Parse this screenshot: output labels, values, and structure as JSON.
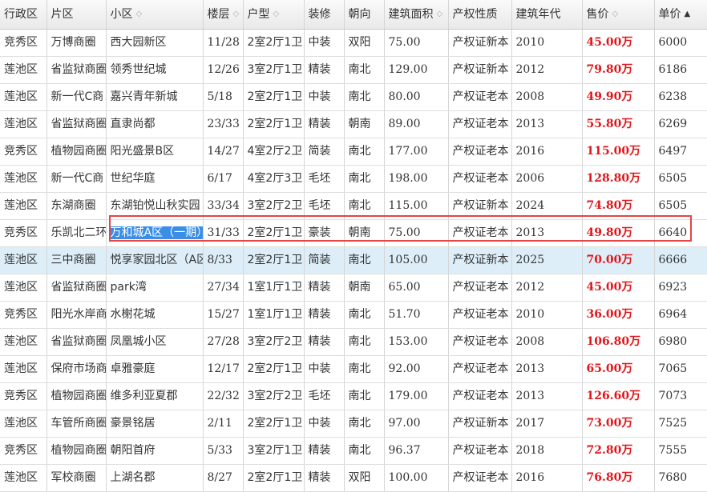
{
  "headers": [
    {
      "label": "行政区",
      "sort": ""
    },
    {
      "label": "片区",
      "sort": ""
    },
    {
      "label": "小区",
      "sort": "◇"
    },
    {
      "label": "楼层",
      "sort": "◇"
    },
    {
      "label": "户型",
      "sort": "◇"
    },
    {
      "label": "装修",
      "sort": ""
    },
    {
      "label": "朝向",
      "sort": ""
    },
    {
      "label": "建筑面积",
      "sort": "◇"
    },
    {
      "label": "产权性质",
      "sort": ""
    },
    {
      "label": "建筑年代",
      "sort": ""
    },
    {
      "label": "售价",
      "sort": "◇"
    },
    {
      "label": "单价",
      "sort": "▲"
    }
  ],
  "rows": [
    [
      "竞秀区",
      "万博商圈",
      "西大园新区",
      "11/28",
      "2室2厅1卫",
      "中装",
      "双阳",
      "75.00",
      "产权证新本",
      "2010",
      "45.00万",
      "6000"
    ],
    [
      "莲池区",
      "省监狱商圈",
      "领秀世纪城",
      "12/26",
      "3室2厅1卫",
      "精装",
      "南北",
      "129.00",
      "产权证新本",
      "2012",
      "79.80万",
      "6186"
    ],
    [
      "莲池区",
      "新一代C商",
      "嘉兴青年新城",
      "5/18",
      "2室2厅1卫",
      "中装",
      "南北",
      "80.00",
      "产权证老本",
      "2008",
      "49.90万",
      "6238"
    ],
    [
      "莲池区",
      "省监狱商圈",
      "直隶尚都",
      "23/33",
      "2室2厅1卫",
      "精装",
      "朝南",
      "89.00",
      "产权证老本",
      "2013",
      "55.80万",
      "6269"
    ],
    [
      "竞秀区",
      "植物园商圈",
      "阳光盛景B区",
      "14/27",
      "4室2厅2卫",
      "简装",
      "南北",
      "177.00",
      "产权证老本",
      "2016",
      "115.00万",
      "6497"
    ],
    [
      "莲池区",
      "新一代C商",
      "世纪华庭",
      "6/17",
      "4室2厅3卫",
      "毛坯",
      "南北",
      "198.00",
      "产权证老本",
      "2006",
      "128.80万",
      "6505"
    ],
    [
      "莲池区",
      "东湖商圈",
      "东湖铂悦山秋实园",
      "33/34",
      "3室2厅2卫",
      "毛坯",
      "南北",
      "115.00",
      "产权证新本",
      "2024",
      "74.80万",
      "6505"
    ],
    [
      "竞秀区",
      "乐凯北二环",
      "万和城A区（一期）",
      "31/33",
      "2室2厅1卫",
      "豪装",
      "朝南",
      "75.00",
      "产权证老本",
      "2013",
      "49.80万",
      "6640"
    ],
    [
      "莲池区",
      "三中商圈",
      "悦享家园北区（A区",
      "8/33",
      "2室2厅1卫",
      "简装",
      "南北",
      "105.00",
      "产权证新本",
      "2025",
      "70.00万",
      "6666"
    ],
    [
      "莲池区",
      "省监狱商圈",
      "park湾",
      "27/34",
      "1室1厅1卫",
      "精装",
      "朝南",
      "65.00",
      "产权证老本",
      "2012",
      "45.00万",
      "6923"
    ],
    [
      "竞秀区",
      "阳光水岸商",
      "水榭花城",
      "15/27",
      "1室1厅1卫",
      "精装",
      "南北",
      "51.70",
      "产权证老本",
      "2010",
      "36.00万",
      "6964"
    ],
    [
      "莲池区",
      "省监狱商圈",
      "凤凰城小区",
      "27/28",
      "3室2厅2卫",
      "精装",
      "南北",
      "153.00",
      "产权证老本",
      "2008",
      "106.80万",
      "6980"
    ],
    [
      "莲池区",
      "保府市场商",
      "卓雅豪庭",
      "12/17",
      "2室2厅1卫",
      "中装",
      "南北",
      "92.00",
      "产权证老本",
      "2013",
      "65.00万",
      "7065"
    ],
    [
      "竞秀区",
      "植物园商圈",
      "维多利亚夏郡",
      "22/32",
      "3室2厅2卫",
      "毛坯",
      "南北",
      "179.00",
      "产权证老本",
      "2013",
      "126.60万",
      "7073"
    ],
    [
      "莲池区",
      "车管所商圈",
      "豪景铭居",
      "2/11",
      "2室2厅1卫",
      "中装",
      "南北",
      "97.00",
      "产权证新本",
      "2017",
      "73.00万",
      "7525"
    ],
    [
      "竞秀区",
      "植物园商圈",
      "朝阳首府",
      "5/33",
      "3室2厅1卫",
      "精装",
      "南北",
      "96.37",
      "产权证老本",
      "2018",
      "72.80万",
      "7555"
    ],
    [
      "莲池区",
      "军校商圈",
      "上湖名郡",
      "8/27",
      "2室2厅1卫",
      "精装",
      "双阳",
      "100.00",
      "产权证老本",
      "2016",
      "76.80万",
      "7680"
    ]
  ],
  "selected_row_index": 7,
  "hover_row_index": 8,
  "colors": {
    "price": "#e0161a",
    "hover_row": "#ddeef8",
    "frame": "#e64545",
    "selection": "#3a8ee6"
  }
}
